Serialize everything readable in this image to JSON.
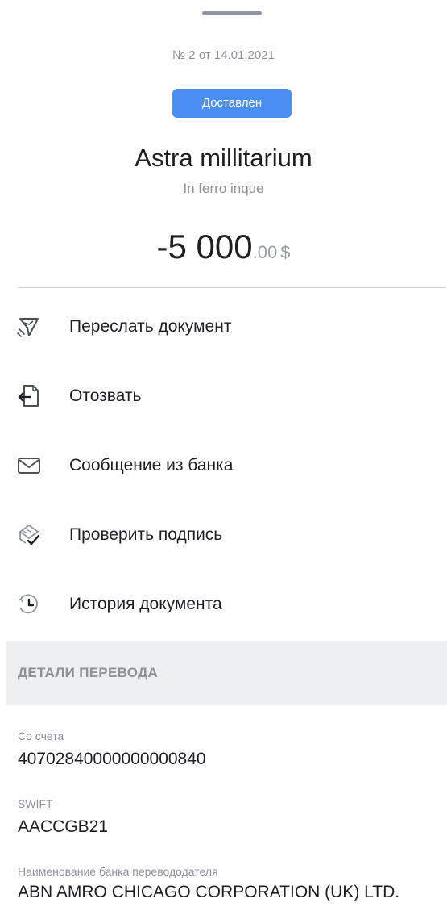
{
  "header": {
    "doc_number": "№ 2 от 14.01.2021",
    "status": "Доставлен",
    "title": "Astra millitarium",
    "subtitle": "In ferro inque"
  },
  "amount": {
    "integer": "-5 000",
    "fraction": ".00",
    "currency": "$"
  },
  "actions": [
    {
      "label": "Переслать документ",
      "icon": "send-paper-plane-icon"
    },
    {
      "label": "Отозвать",
      "icon": "revoke-document-icon"
    },
    {
      "label": "Сообщение из банка",
      "icon": "envelope-icon"
    },
    {
      "label": "Проверить подпись",
      "icon": "verify-signature-icon"
    },
    {
      "label": "История документа",
      "icon": "history-clock-icon"
    }
  ],
  "details": {
    "section_title": "ДЕТАЛИ ПЕРЕВОДА",
    "fields": [
      {
        "label": "Со счета",
        "value": "40702840000000000840"
      },
      {
        "label": "SWIFT",
        "value": "AACCGB21"
      },
      {
        "label": "Наименование банка перевододателя",
        "value": "ABN AMRO CHICAGO CORPORATION (UK) LTD."
      }
    ]
  },
  "colors": {
    "accent": "#4a8ef3",
    "text_primary": "#1d1f23",
    "text_secondary": "#8d9199",
    "section_bg": "#eeeff1"
  }
}
